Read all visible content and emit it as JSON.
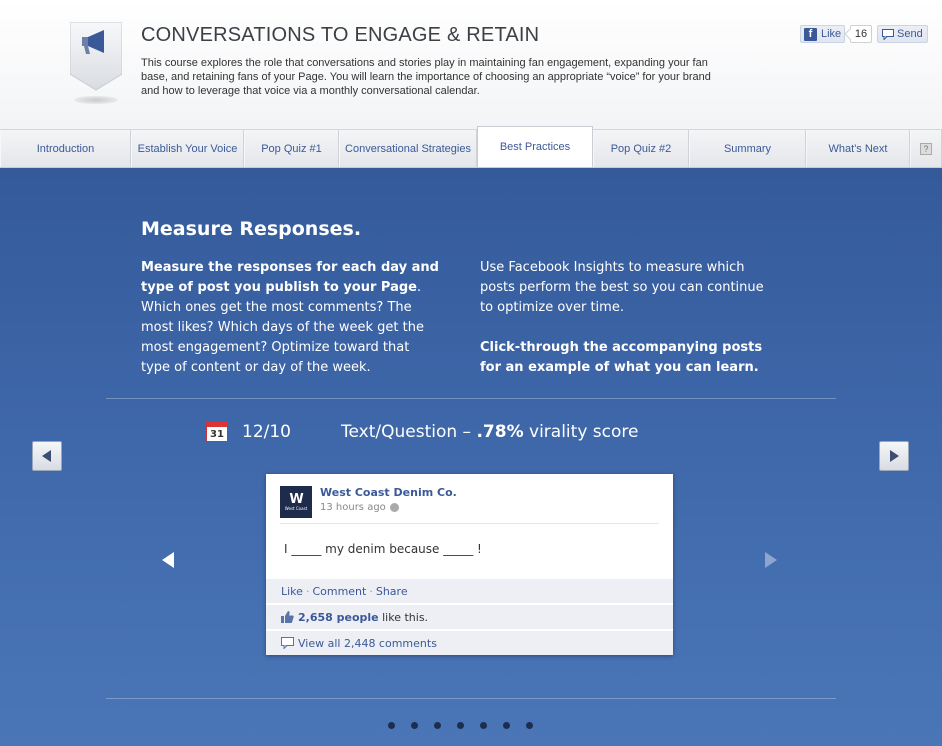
{
  "header": {
    "title": "CONVERSATIONS TO ENGAGE & RETAIN",
    "description": "This course explores the role that conversations and stories play in maintaining fan engagement, expanding your fan base, and retaining fans of your Page. You will learn the importance of choosing an appropriate “voice” for your brand and how to leverage that voice via a monthly conversational calendar.",
    "badge_icon": "megaphone-icon",
    "like_label": "Like",
    "like_count": "16",
    "send_label": "Send"
  },
  "tabs": [
    {
      "label": "Introduction"
    },
    {
      "label": "Establish Your Voice"
    },
    {
      "label": "Pop Quiz #1"
    },
    {
      "label": "Conversational Strategies"
    },
    {
      "label": "Best Practices",
      "active": true
    },
    {
      "label": "Pop Quiz #2"
    },
    {
      "label": "Summary"
    },
    {
      "label": "What's Next"
    },
    {
      "label": "?"
    }
  ],
  "content": {
    "heading": "Measure Responses.",
    "left_bold": "Measure the responses for each day and type of post you publish to your Page",
    "left_rest": ". Which ones get the most comments? The most likes? Which days of the week get the most engagement? Optimize toward that type of content or day of the week.",
    "right_p1": "Use Facebook Insights to measure which posts perform the best so you can continue to optimize over time.",
    "right_p2": "Click-through the accompanying posts for an example of what you can learn."
  },
  "stat": {
    "calendar_day": "31",
    "date": "12/10",
    "type_prefix": "Text/Question – ",
    "score": ".78%",
    "score_suffix": " virality score"
  },
  "post": {
    "avatar_text": "W",
    "avatar_sub": "West Coast",
    "page_name": "West Coast Denim Co.",
    "time": "13 hours ago",
    "text": "I _____ my denim because _____ !",
    "actions": [
      "Like",
      "Comment",
      "Share"
    ],
    "likes_count": "2,658 people",
    "likes_suffix": " like this.",
    "comments": "View all 2,448 comments"
  },
  "colors": {
    "accent": "#3b5998",
    "main_bg": "#3d66a8"
  },
  "pagination": {
    "count": 7
  }
}
